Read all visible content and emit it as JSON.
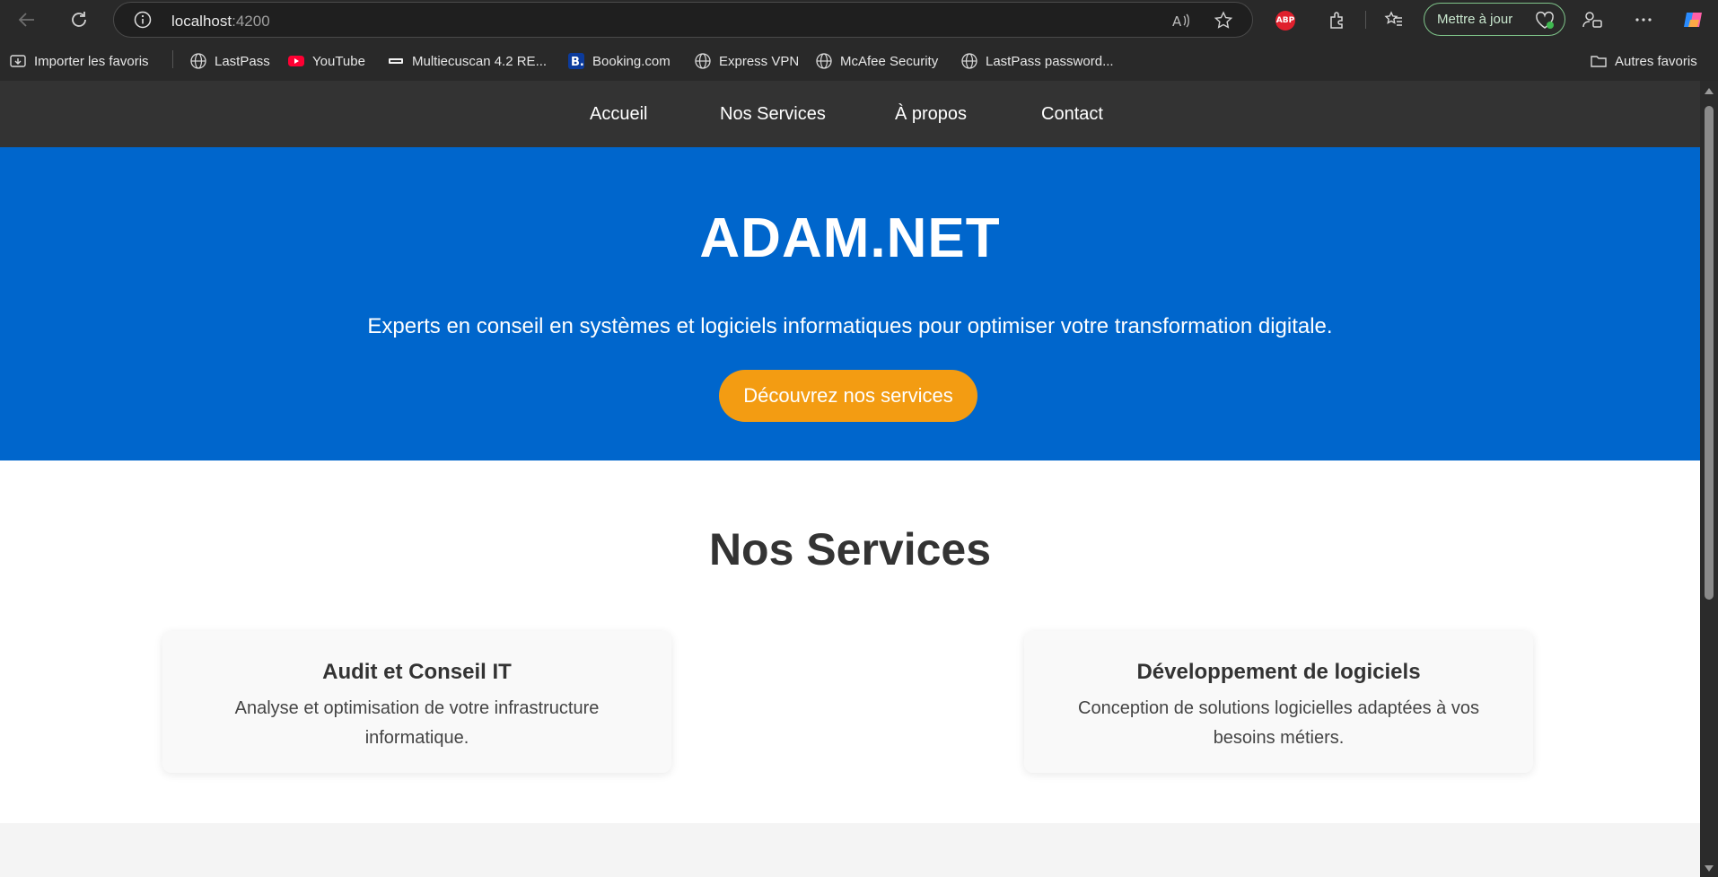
{
  "browser": {
    "url_host": "localhost",
    "url_port": ":4200",
    "update_button_label": "Mettre à jour",
    "adblock_label": "ABP",
    "bookmarks": [
      {
        "label": "Importer les favoris",
        "icon": "import-icon"
      },
      {
        "label": "LastPass",
        "icon": "globe-icon"
      },
      {
        "label": "YouTube",
        "icon": "youtube-icon"
      },
      {
        "label": "Multiecuscan 4.2 RE...",
        "icon": "multiecuscan-icon"
      },
      {
        "label": "Booking.com",
        "icon": "booking-icon"
      },
      {
        "label": "Express VPN",
        "icon": "globe-icon"
      },
      {
        "label": "McAfee Security",
        "icon": "globe-icon"
      },
      {
        "label": "LastPass password...",
        "icon": "globe-icon"
      }
    ],
    "other_favorites": "Autres favoris"
  },
  "site": {
    "nav": [
      "Accueil",
      "Nos Services",
      "À propos",
      "Contact"
    ],
    "hero": {
      "title": "ADAM.NET",
      "subtitle": "Experts en conseil en systèmes et logiciels informatiques pour optimiser votre transformation digitale.",
      "cta": "Découvrez nos services"
    },
    "services": {
      "heading": "Nos Services",
      "items": [
        {
          "title": "Audit et Conseil IT",
          "description": "Analyse et optimisation de votre infrastructure informatique."
        },
        {
          "title": "Développement de logiciels",
          "description": "Conception de solutions logicielles adaptées à vos besoins métiers."
        }
      ]
    }
  },
  "colors": {
    "nav_bg": "#333333",
    "hero_bg": "#0066cc",
    "cta_bg": "#f39c12"
  }
}
